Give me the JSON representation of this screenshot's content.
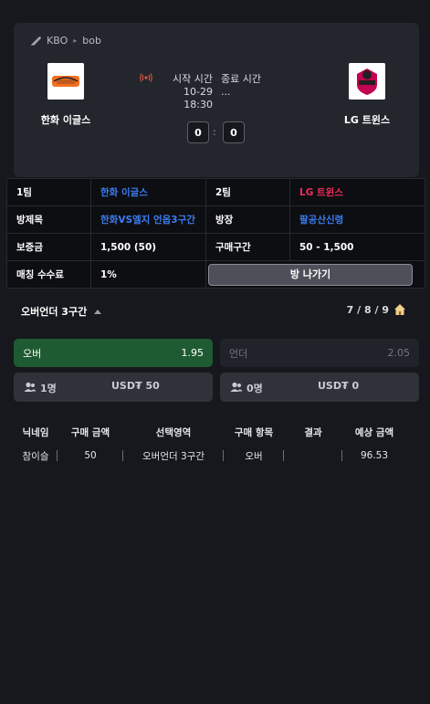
{
  "breadcrumb": {
    "league": "KBO",
    "game": "bob"
  },
  "match": {
    "home_team": "한화 이글스",
    "away_team": "LG 트윈스",
    "start_label": "시작 시간",
    "start_value": "10-29 18:30",
    "end_label": "종료 시간",
    "end_value": "...",
    "home_score": "0",
    "away_score": "0",
    "score_sep": ":"
  },
  "info": {
    "team1_label": "1팀",
    "team1_value": "한화 이글스",
    "team2_label": "2팀",
    "team2_value": "LG 트윈스",
    "room_title_label": "방제목",
    "room_title_value": "한화VS엘지 언옵3구간",
    "host_label": "방장",
    "host_value": "팔공산신령",
    "deposit_label": "보증금",
    "deposit_value": "1,500 (50)",
    "range_label": "구매구간",
    "range_value": "50 - 1,500",
    "fee_label": "매칭 수수료",
    "fee_value": "1%",
    "exit_button": "방 나가기"
  },
  "market": {
    "title": "오버언더 3구간",
    "rounds": "7 / 8 / 9",
    "over_label": "오버",
    "over_odds": "1.95",
    "under_label": "언더",
    "under_odds": "2.05",
    "over_count": "1명",
    "over_amount": "USD₮ 50",
    "under_count": "0명",
    "under_amount": "USD₮ 0"
  },
  "bets": {
    "headers": [
      "닉네임",
      "구매 금액",
      "선택영역",
      "구매 항목",
      "결과",
      "예상 금액"
    ],
    "rows": [
      [
        "참이슬",
        "50",
        "오버언더 3구간",
        "오버",
        "",
        "96.53"
      ]
    ]
  },
  "colors": {
    "team_blue": "#3b7cf2",
    "team_pink": "#ef2e5b",
    "over_green": "#1f5b32"
  }
}
